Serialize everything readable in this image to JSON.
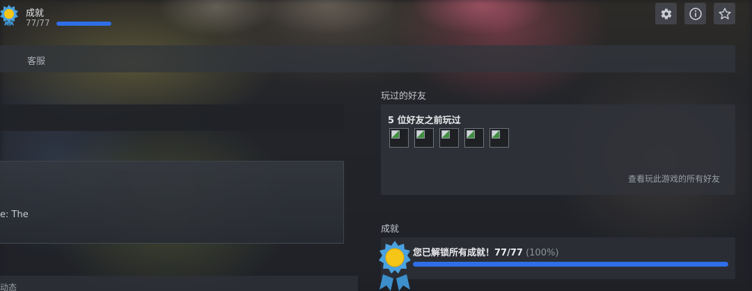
{
  "header": {
    "title": "成就",
    "progress_text": "77/77",
    "progress_fraction": 1.0
  },
  "header_buttons": [
    {
      "icon": "gear-icon"
    },
    {
      "icon": "info-icon"
    },
    {
      "icon": "star-icon"
    }
  ],
  "nav": {
    "items": [
      "客服"
    ]
  },
  "left": {
    "panel_text": "e: The",
    "bottom_text": "动态"
  },
  "friends": {
    "section_title": "玩过的好友",
    "count_text": "5 位好友之前玩过",
    "avatar_count": 5,
    "see_all": "查看玩此游戏的所有好友"
  },
  "achievements": {
    "section_title": "成就",
    "unlocked_text": "您已解锁所有成就！77/77",
    "percent_text": "(100%)",
    "progress_fraction": 1.0
  },
  "colors": {
    "accent": "#2f6ee7",
    "medal_gold": "#f5c518",
    "medal_ribbon": "#4aa3e0"
  }
}
